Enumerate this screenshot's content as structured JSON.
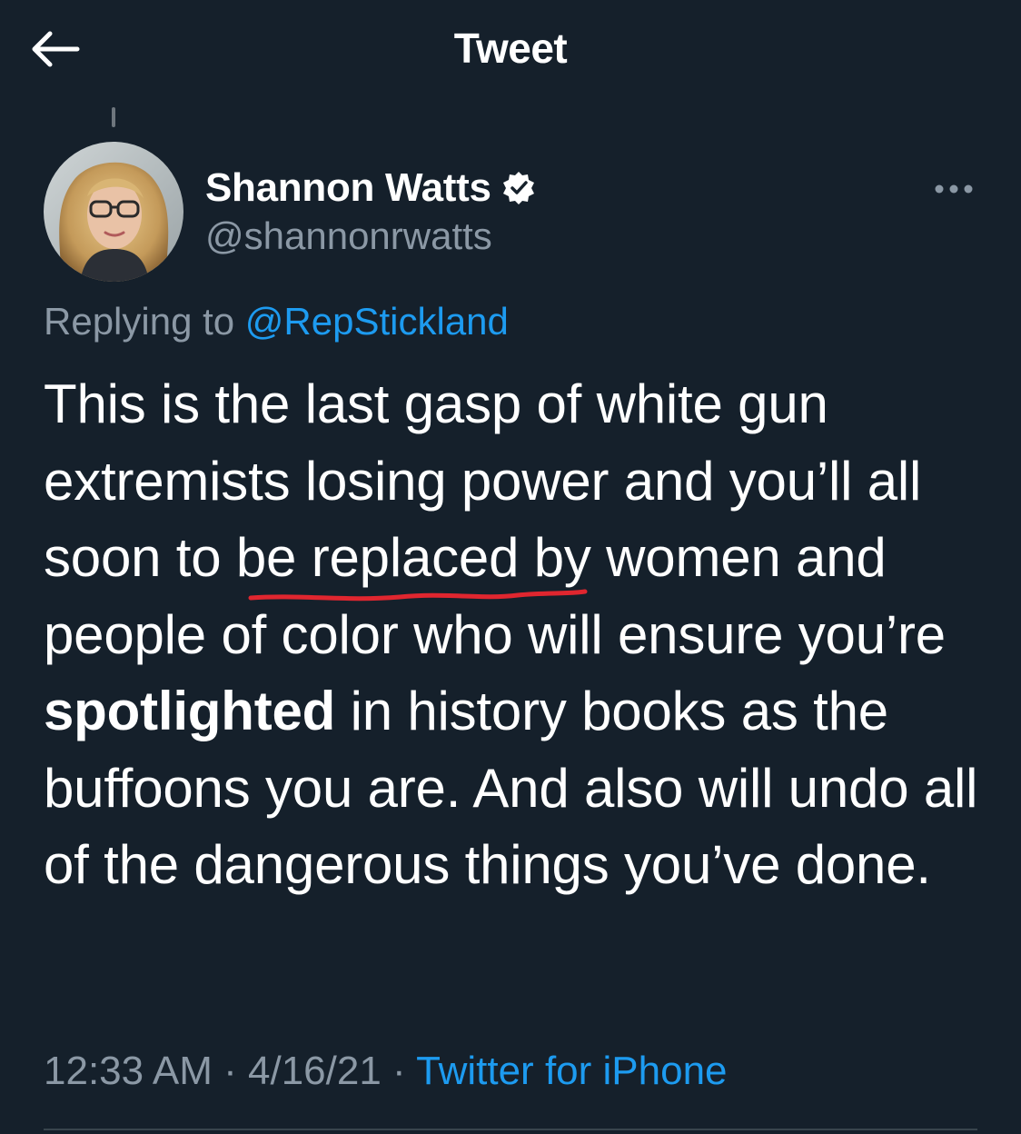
{
  "header": {
    "title": "Tweet",
    "back_icon": "arrow-left-icon"
  },
  "author": {
    "display_name": "Shannon Watts",
    "handle": "@shannonrwatts",
    "verified_icon": "verified-badge-icon"
  },
  "more_icon": "more-horizontal-icon",
  "reply_context": {
    "prefix": "Replying to ",
    "mention": "@RepStickland"
  },
  "tweet": {
    "text_part1": "This is the last gasp of white gun extremists losing power and you’ll all soon to be replaced by women and people of color who will ensure you’re ",
    "text_bold": "spotlighted",
    "text_part2": " in history books as the buffoons you are. And also will undo all of the dangerous things you’ve done."
  },
  "meta": {
    "time": "12:33 AM",
    "separator1": " · ",
    "date": "4/16/21",
    "separator2": " · ",
    "source": "Twitter for iPhone"
  },
  "colors": {
    "background": "#15202b",
    "accent": "#1d9bf0",
    "secondary_text": "#8b98a5",
    "annotation_underline": "#e0262f"
  }
}
